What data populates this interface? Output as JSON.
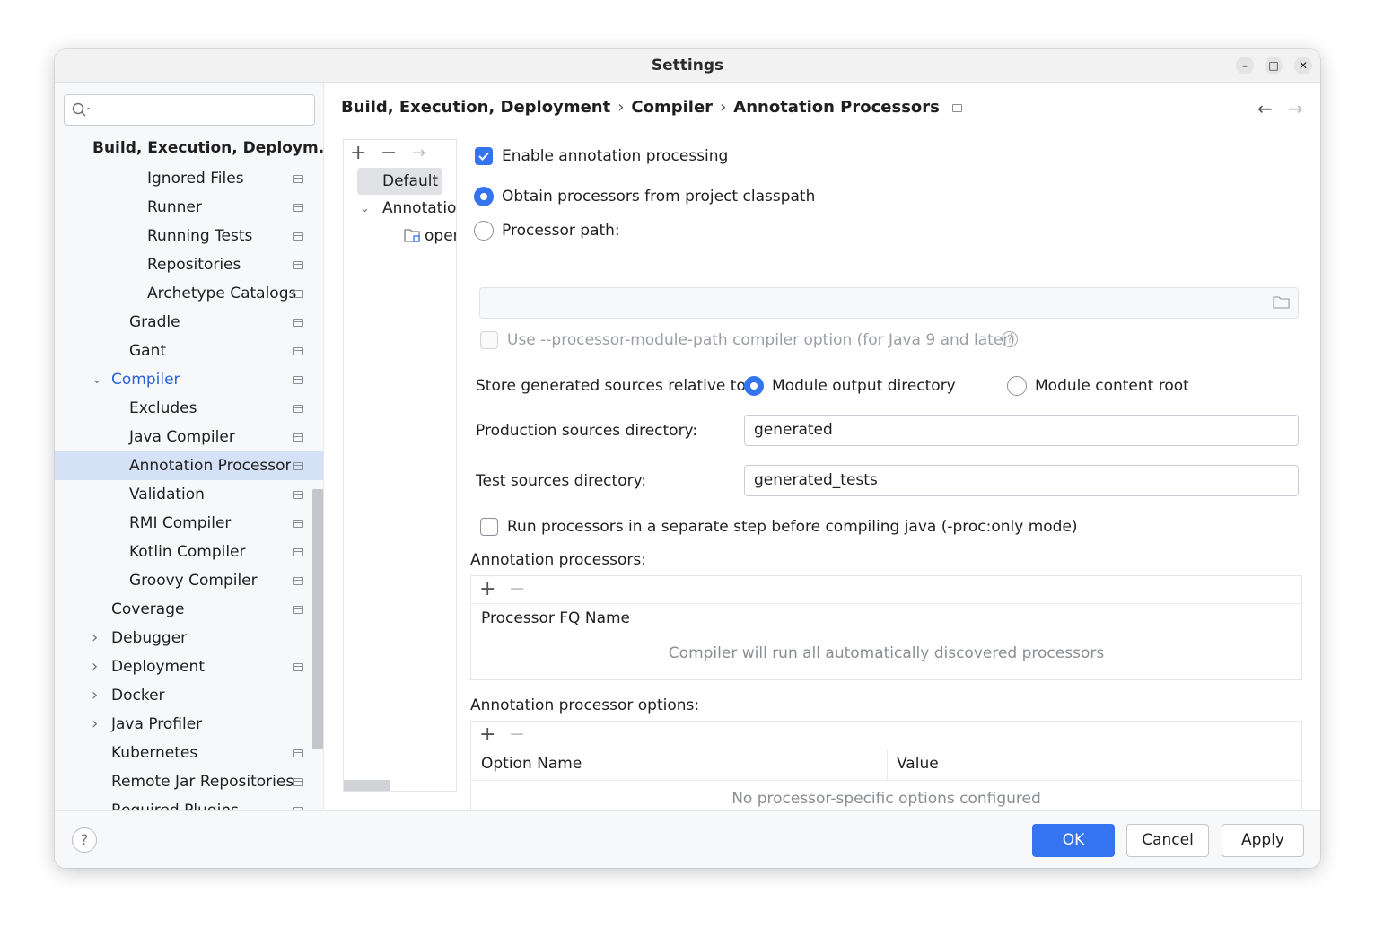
{
  "window": {
    "title": "Settings"
  },
  "sidebar": {
    "items": [
      {
        "label": "Build, Execution, Deploym...",
        "bold": true,
        "page": false
      },
      {
        "label": "Ignored Files",
        "page": true
      },
      {
        "label": "Runner",
        "page": true
      },
      {
        "label": "Running Tests",
        "page": true
      },
      {
        "label": "Repositories",
        "page": true
      },
      {
        "label": "Archetype Catalogs",
        "page": true
      },
      {
        "label": "Gradle",
        "page": true
      },
      {
        "label": "Gant",
        "page": true
      },
      {
        "label": "Compiler",
        "page": true,
        "expanded": true,
        "highlight": true
      },
      {
        "label": "Excludes",
        "page": true
      },
      {
        "label": "Java Compiler",
        "page": true
      },
      {
        "label": "Annotation Processors",
        "page": true,
        "selected": true
      },
      {
        "label": "Validation",
        "page": true
      },
      {
        "label": "RMI Compiler",
        "page": true
      },
      {
        "label": "Kotlin Compiler",
        "page": true
      },
      {
        "label": "Groovy Compiler",
        "page": true
      },
      {
        "label": "Coverage",
        "page": true
      },
      {
        "label": "Debugger",
        "page": false,
        "collapsed": true
      },
      {
        "label": "Deployment",
        "page": true,
        "collapsed": true
      },
      {
        "label": "Docker",
        "page": false,
        "collapsed": true
      },
      {
        "label": "Java Profiler",
        "page": false,
        "collapsed": true
      },
      {
        "label": "Kubernetes",
        "page": true
      },
      {
        "label": "Remote Jar Repositories",
        "page": true
      },
      {
        "label": "Required Plugins",
        "page": true
      }
    ]
  },
  "breadcrumb": [
    "Build, Execution, Deployment",
    "Compiler",
    "Annotation Processors"
  ],
  "profiles": {
    "default_label": "Default",
    "group_label": "Annotatior",
    "module_label": "oper"
  },
  "form": {
    "enable_label": "Enable annotation processing",
    "enable_checked": true,
    "obtain_label": "Obtain processors from project classpath",
    "processor_path_label": "Processor path:",
    "processor_path_value": "",
    "module_path_label": "Use --processor-module-path compiler option (for Java 9 and later)",
    "store_label": "Store generated sources relative to:",
    "module_output_label": "Module output directory",
    "module_content_label": "Module content root",
    "production_label": "Production sources directory:",
    "production_value": "generated",
    "test_label": "Test sources directory:",
    "test_value": "generated_tests",
    "run_separate_label": "Run processors in a separate step before compiling java (-proc:only mode)",
    "processors_title": "Annotation processors:",
    "processors_column": "Processor FQ Name",
    "processors_empty": "Compiler will run all automatically discovered processors",
    "options_title": "Annotation processor options:",
    "options_columns": [
      "Option Name",
      "Value"
    ],
    "options_empty": "No processor-specific options configured"
  },
  "footer": {
    "ok": "OK",
    "cancel": "Cancel",
    "apply": "Apply",
    "help": "?"
  },
  "colors": {
    "accent": "#3574f0",
    "selection": "#d5e1f7",
    "link": "#2a63d9"
  }
}
